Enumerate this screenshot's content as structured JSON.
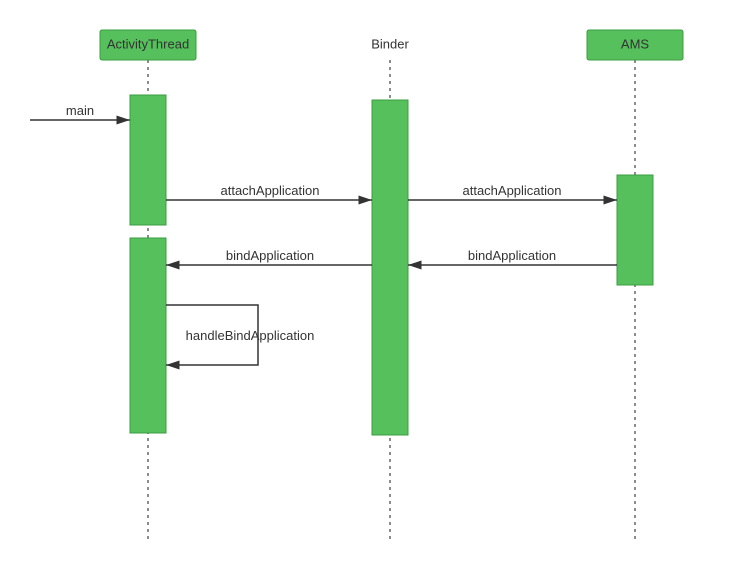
{
  "lifelines": {
    "activityThread": {
      "label": "ActivityThread"
    },
    "binder": {
      "label": "Binder"
    },
    "ams": {
      "label": "AMS"
    }
  },
  "messages": {
    "main": "main",
    "attach1": "attachApplication",
    "attach2": "attachApplication",
    "bind1": "bindApplication",
    "bind2": "bindApplication",
    "handleBind": "handleBindApplication"
  },
  "chart_data": {
    "type": "sequence-diagram",
    "lifelines": [
      "ActivityThread",
      "Binder",
      "AMS"
    ],
    "messages": [
      {
        "from": "external",
        "to": "ActivityThread",
        "label": "main",
        "kind": "call"
      },
      {
        "from": "ActivityThread",
        "to": "Binder",
        "label": "attachApplication",
        "kind": "call"
      },
      {
        "from": "Binder",
        "to": "AMS",
        "label": "attachApplication",
        "kind": "call"
      },
      {
        "from": "AMS",
        "to": "Binder",
        "label": "bindApplication",
        "kind": "return"
      },
      {
        "from": "Binder",
        "to": "ActivityThread",
        "label": "bindApplication",
        "kind": "return"
      },
      {
        "from": "ActivityThread",
        "to": "ActivityThread",
        "label": "handleBindApplication",
        "kind": "self-call"
      }
    ]
  }
}
